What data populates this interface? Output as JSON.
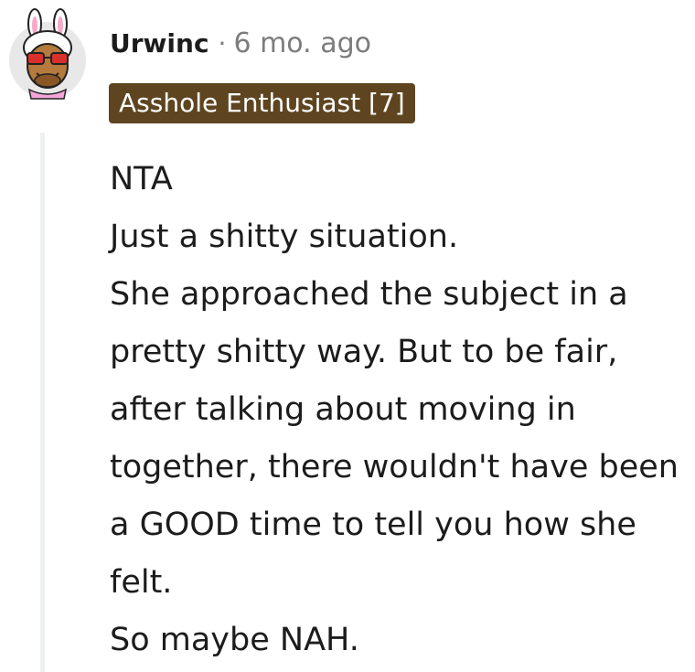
{
  "comment": {
    "author": "Urwinc",
    "separator": "·",
    "timestamp": "6 mo. ago",
    "flair": "Asshole Enthusiast [7]",
    "flair_color": "#5e4520",
    "avatar_icon": "bunny-ears-sunglasses-avatar-icon",
    "body_lines": [
      "NTA",
      "Just a shitty situation.",
      "She approached the subject in a pretty shitty way. But to be fair, after talking about moving in together, there wouldn't have been a GOOD time to tell you how she felt.",
      "So maybe NAH."
    ]
  }
}
